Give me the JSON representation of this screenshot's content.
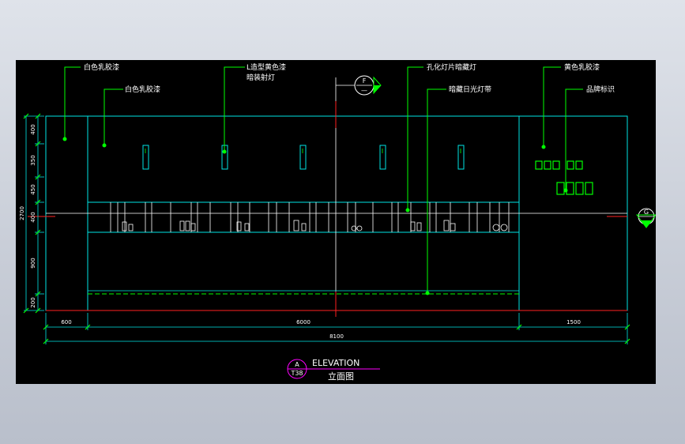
{
  "drawing": {
    "title_en": "ELEVATION",
    "title_cn": "立面图",
    "ref_letter": "A",
    "ref_sheet": "T38"
  },
  "markers": {
    "top_letter": "F",
    "right_letter": "G"
  },
  "labels": {
    "white_latex_1": "白色乳胶漆",
    "white_latex_2": "白色乳胶漆",
    "l_yellow_1": "L造型黄色漆",
    "l_yellow_2": "暗装射灯",
    "hole_light": "孔化灯片暗藏灯",
    "hidden_strip": "暗藏日光灯带",
    "yellow_latex": "黄色乳胶漆",
    "brand_logo": "品牌标识"
  },
  "dimensions": {
    "horizontal": [
      "600",
      "6000",
      "1500"
    ],
    "total": "8100",
    "vertical": [
      "400",
      "350",
      "450",
      "400",
      "900",
      "200"
    ],
    "vertical_total": "2700"
  },
  "colors": {
    "cyan": "#00e5e5",
    "green": "#00ff00",
    "red": "#ff2020",
    "magenta": "#ff00ff",
    "white": "#ffffff"
  }
}
